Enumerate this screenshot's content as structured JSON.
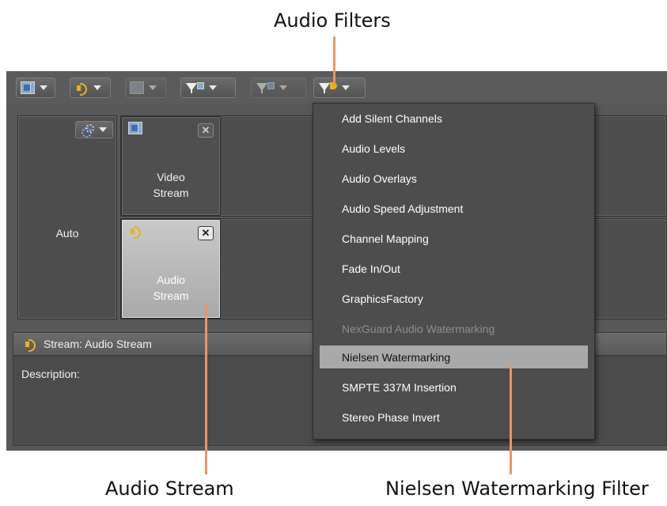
{
  "callouts": {
    "audio_filters": "Audio Filters",
    "audio_stream": "Audio Stream",
    "nielsen_filter": "Nielsen Watermarking Filter"
  },
  "colors": {
    "leader_line": "#e8956a",
    "app_background": "#585858",
    "menu_highlight": "#a9a9a9"
  },
  "toolbar": {
    "buttons": [
      {
        "icon": "video-icon",
        "state": "enabled"
      },
      {
        "icon": "audio-icon",
        "state": "enabled"
      },
      {
        "icon": "data-icon",
        "state": "disabled"
      },
      {
        "icon": "video-filter-icon",
        "state": "enabled"
      },
      {
        "icon": "data-filter-icon",
        "state": "disabled"
      },
      {
        "icon": "audio-filter-icon",
        "state": "active"
      }
    ]
  },
  "auto_panel": {
    "label": "Auto",
    "dropdown_icon": "gear-icon"
  },
  "streams": {
    "video": {
      "label": "Video Stream",
      "icon": "video-icon"
    },
    "audio": {
      "label": "Audio Stream",
      "icon": "audio-icon",
      "selected": true
    }
  },
  "properties": {
    "title": "Stream: Audio Stream",
    "description_label": "Description:"
  },
  "audio_filter_menu": {
    "items": [
      {
        "label": "Add Silent Channels",
        "state": "enabled"
      },
      {
        "label": "Audio Levels",
        "state": "enabled"
      },
      {
        "label": "Audio Overlays",
        "state": "enabled"
      },
      {
        "label": "Audio Speed Adjustment",
        "state": "enabled"
      },
      {
        "label": "Channel Mapping",
        "state": "enabled"
      },
      {
        "label": "Fade In/Out",
        "state": "enabled"
      },
      {
        "label": "GraphicsFactory",
        "state": "enabled"
      },
      {
        "label": "NexGuard Audio Watermarking",
        "state": "disabled"
      },
      {
        "label": "Nielsen Watermarking",
        "state": "highlighted"
      },
      {
        "label": "SMPTE 337M Insertion",
        "state": "enabled"
      },
      {
        "label": "Stereo Phase Invert",
        "state": "enabled"
      }
    ]
  }
}
